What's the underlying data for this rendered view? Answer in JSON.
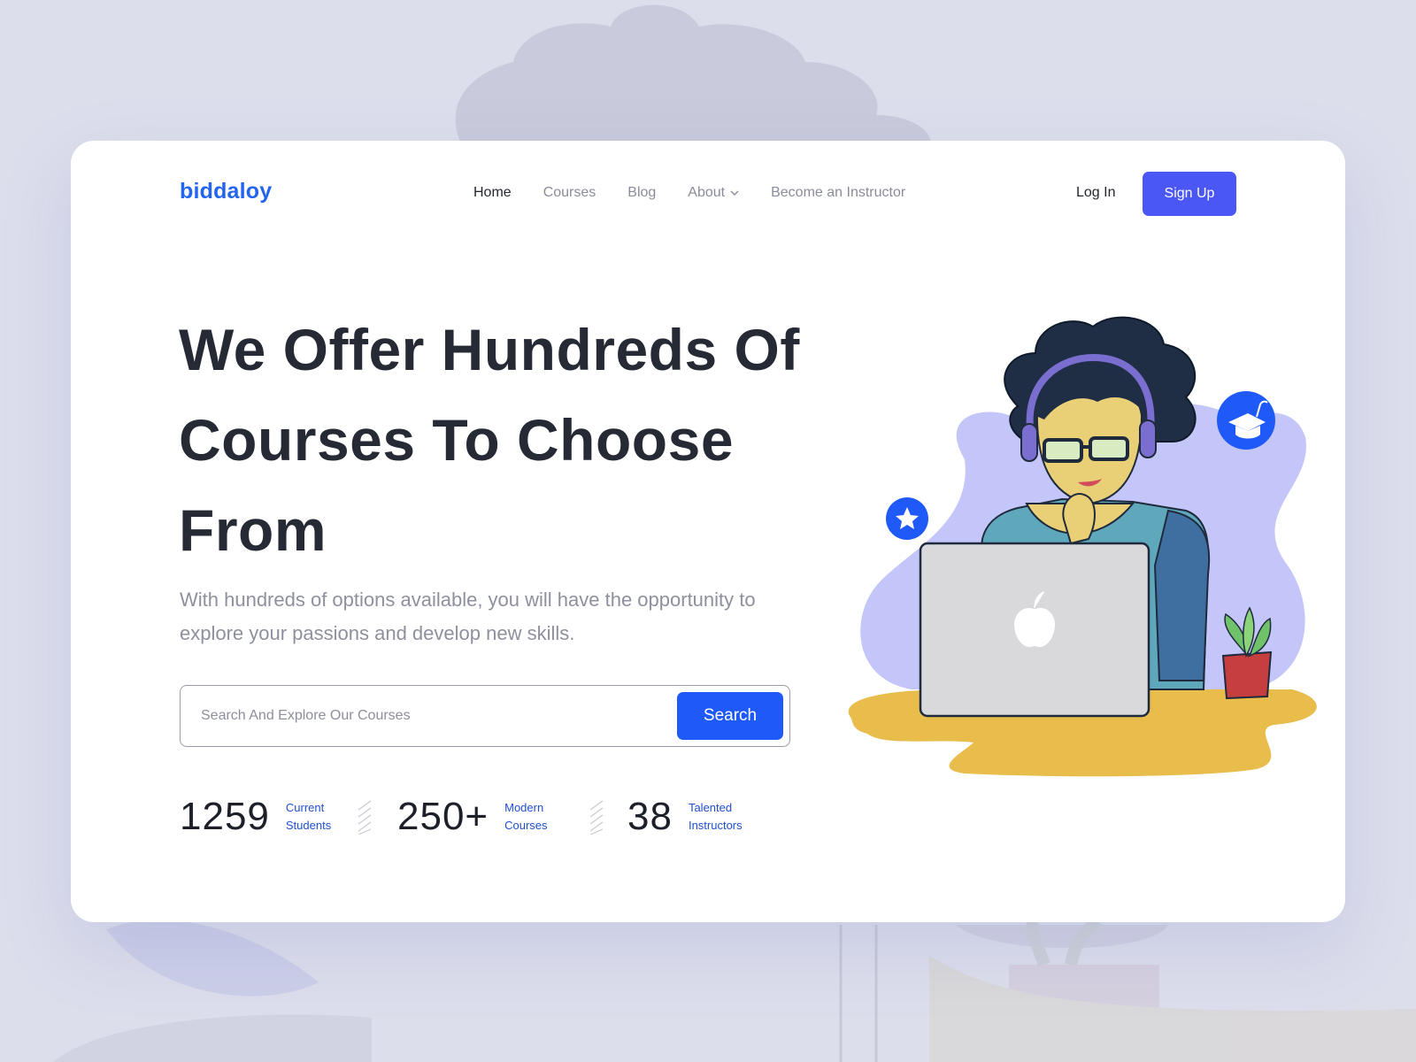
{
  "brand": {
    "logo": "biddaloy",
    "accent": "#2364f0",
    "button_color": "#4b57f5",
    "search_color": "#1f5af8"
  },
  "nav": {
    "items": [
      {
        "label": "Home",
        "active": true
      },
      {
        "label": "Courses",
        "active": false
      },
      {
        "label": "Blog",
        "active": false
      },
      {
        "label": "About",
        "active": false,
        "dropdown": true
      },
      {
        "label": "Become an Instructor",
        "active": false
      }
    ],
    "login": "Log In",
    "signup": "Sign Up"
  },
  "hero": {
    "title_lines": [
      "We Offer Hundreds Of",
      "Courses To Choose",
      "From"
    ],
    "description": "With hundreds of options available, you will have the opportunity to explore your passions and develop new skills."
  },
  "search": {
    "placeholder": "Search And Explore Our Courses",
    "button": "Search"
  },
  "stats": [
    {
      "value": "1259",
      "label_line1": "Current",
      "label_line2": "Students"
    },
    {
      "value": "250+",
      "label_line1": "Modern",
      "label_line2": "Courses"
    },
    {
      "value": "38",
      "label_line1": "Talented",
      "label_line2": "Instructors"
    }
  ],
  "illustration": {
    "icons": [
      "star-badge-icon",
      "graduation-cap-badge-icon",
      "apple-logo-icon",
      "headphones-icon",
      "plant-icon",
      "laptop-icon"
    ]
  }
}
